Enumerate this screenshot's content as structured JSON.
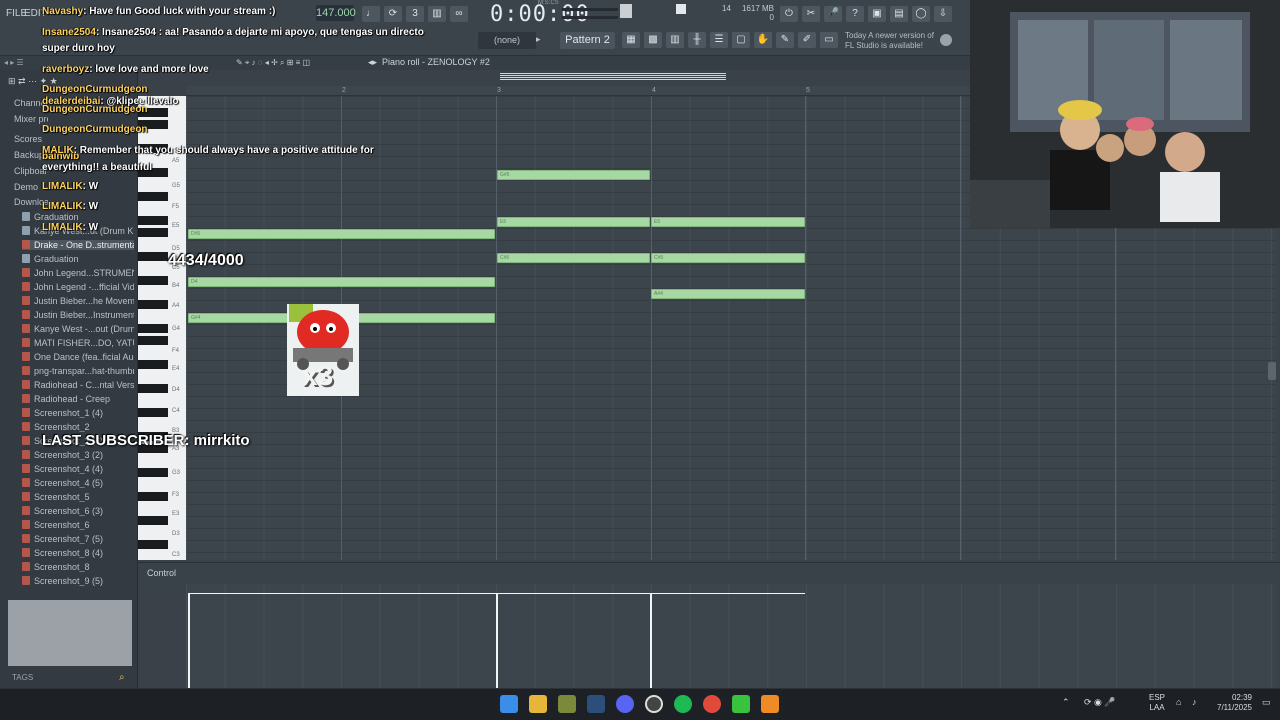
{
  "menu": {
    "file": "FILE",
    "edit": "EDIT"
  },
  "transport": {
    "tempo": "147.000",
    "time": "0:00:00",
    "mscs": "M:S:CS"
  },
  "toolbar": {
    "pattern": "Pattern 2",
    "none_selector": "(none)",
    "cpu_line1": "1617 MB",
    "cpu_line2": "0",
    "cpu_voice": "14",
    "news": "Today  A newer version of FL Studio is available!"
  },
  "piano_roll": {
    "title": "Piano roll - ZENOLOGY #2",
    "bars": [
      "2",
      "3",
      "4",
      "5"
    ]
  },
  "browser": {
    "items": [
      {
        "label": "Graduation",
        "type": "folder"
      },
      {
        "label": "Kanye West...ut (Drum Kit)",
        "type": "folder"
      },
      {
        "label": "Drake - One D..strumental)",
        "type": "file",
        "selected": true
      },
      {
        "label": "Graduation",
        "type": "folder"
      },
      {
        "label": "John Legend...STRUMENTAL)",
        "type": "file"
      },
      {
        "label": "John Legend -...fficial Video)",
        "type": "file"
      },
      {
        "label": "Justin Bieber...he Movement)",
        "type": "file"
      },
      {
        "label": "Justin Bieber...Instrumental)",
        "type": "file"
      },
      {
        "label": "Kanye West -...out (Drum Kit)",
        "type": "file"
      },
      {
        "label": "MATI FISHER...DO, YATUSABE.",
        "type": "file"
      },
      {
        "label": "One Dance (fea..ficial Audio)",
        "type": "file"
      },
      {
        "label": "png-transpar...hat-thumbnail",
        "type": "file"
      },
      {
        "label": "Radiohead - C...ntal Version)",
        "type": "file"
      },
      {
        "label": "Radiohead - Creep",
        "type": "file"
      },
      {
        "label": "Screenshot_1 (4)",
        "type": "file"
      },
      {
        "label": "Screenshot_2",
        "type": "file"
      },
      {
        "label": "Screenshot_2 (4)",
        "type": "file"
      },
      {
        "label": "Screenshot_3 (2)",
        "type": "file"
      },
      {
        "label": "Screenshot_4 (4)",
        "type": "file"
      },
      {
        "label": "Screenshot_4 (5)",
        "type": "file"
      },
      {
        "label": "Screenshot_5",
        "type": "file"
      },
      {
        "label": "Screenshot_6 (3)",
        "type": "file"
      },
      {
        "label": "Screenshot_6",
        "type": "file"
      },
      {
        "label": "Screenshot_7 (5)",
        "type": "file"
      },
      {
        "label": "Screenshot_8 (4)",
        "type": "file"
      },
      {
        "label": "Screenshot_8",
        "type": "file"
      },
      {
        "label": "Screenshot_9 (5)",
        "type": "file"
      }
    ],
    "tree": [
      "Channel",
      "Mixer preset",
      "Scores",
      "Backup",
      "Clipboard",
      "Demo",
      "Downloads"
    ],
    "tags": "TAGS"
  },
  "key_labels": [
    "A5",
    "G5",
    "F5",
    "E5",
    "D5",
    "C5",
    "B4",
    "A4",
    "G4",
    "F4",
    "E4",
    "D4",
    "C4",
    "B3",
    "A3",
    "G3",
    "F3",
    "E3",
    "D3",
    "C3"
  ],
  "notes": [
    {
      "label": "G#5"
    },
    {
      "label": "E5"
    },
    {
      "label": "E5"
    },
    {
      "label": "D#5"
    },
    {
      "label": "C#5"
    },
    {
      "label": "C#5"
    },
    {
      "label": "D4"
    },
    {
      "label": "A#4"
    },
    {
      "label": "G#4"
    }
  ],
  "control": {
    "label": "Control"
  },
  "overlay": {
    "chat": [
      {
        "user": "Navashy",
        "text": ": Have fun Good luck with your stream :)"
      },
      {
        "user": "Insane2504",
        "text": ": Insane2504 : aa! Pasando a dejarte mi apoyo, que tengas un directo"
      },
      {
        "user": "",
        "text": "super duro hoy"
      },
      {
        "user": "raverboyz",
        "text": ": love love and more love"
      },
      {
        "user": "DungeonCurmudgeon",
        "text": ""
      },
      {
        "user": "dealerdeibai",
        "text": ": @klipee llevalo"
      },
      {
        "user": "DungeonCurmudgeon",
        "text": ""
      },
      {
        "user": "DungeonCurmudgeon",
        "text": ""
      },
      {
        "user": "bainwib",
        "text": ""
      },
      {
        "user": "MALIK",
        "text": ": Remember that you should always have a positive attitude for"
      },
      {
        "user": "",
        "text": "everything!! a beautiful"
      },
      {
        "user": "LIMALIK",
        "text": ": W"
      },
      {
        "user": "LIMALIK",
        "text": ": W"
      },
      {
        "user": "LIMALIK",
        "text": ": W"
      }
    ],
    "counter": "4434/4000",
    "last_subscriber": "LAST SUBSCRIBER: mirrkito",
    "multiplier": "x3"
  },
  "taskbar": {
    "lang1": "ESP",
    "lang2": "LAA",
    "time": "02:39",
    "date": "7/11/2025"
  },
  "colors": {
    "note": "#a7d8a3",
    "bg": "#3c454c",
    "toolbar": "#3b434b"
  }
}
